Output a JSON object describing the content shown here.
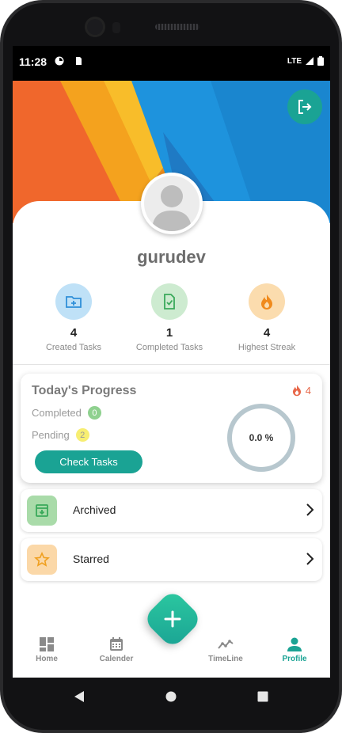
{
  "status_bar": {
    "time": "11:28",
    "network": "LTE"
  },
  "profile": {
    "username": "gurudev"
  },
  "stats": [
    {
      "value": "4",
      "label": "Created Tasks",
      "icon": "folder-plus-icon",
      "bg": "#bfe1f7"
    },
    {
      "value": "1",
      "label": "Completed Tasks",
      "icon": "file-check-icon",
      "bg": "#cdebd0"
    },
    {
      "value": "4",
      "label": "Highest Streak",
      "icon": "fire-icon",
      "bg": "#fbdcae"
    }
  ],
  "progress": {
    "title": "Today's Progress",
    "streak": "4",
    "completed_label": "Completed",
    "completed_count": "0",
    "pending_label": "Pending",
    "pending_count": "2",
    "check_button": "Check Tasks",
    "percent_text": "0.0 %",
    "percent_value": 0
  },
  "list": [
    {
      "label": "Archived",
      "icon": "archive-icon"
    },
    {
      "label": "Starred",
      "icon": "star-icon"
    }
  ],
  "nav": [
    {
      "label": "Home",
      "icon": "dashboard-icon"
    },
    {
      "label": "Calender",
      "icon": "calendar-icon"
    },
    {
      "label": "TimeLine",
      "icon": "timeline-icon"
    },
    {
      "label": "Profile",
      "icon": "person-icon"
    }
  ],
  "colors": {
    "accent": "#1aa394",
    "streak": "#e8684a",
    "ring": "#b7c7ce"
  }
}
